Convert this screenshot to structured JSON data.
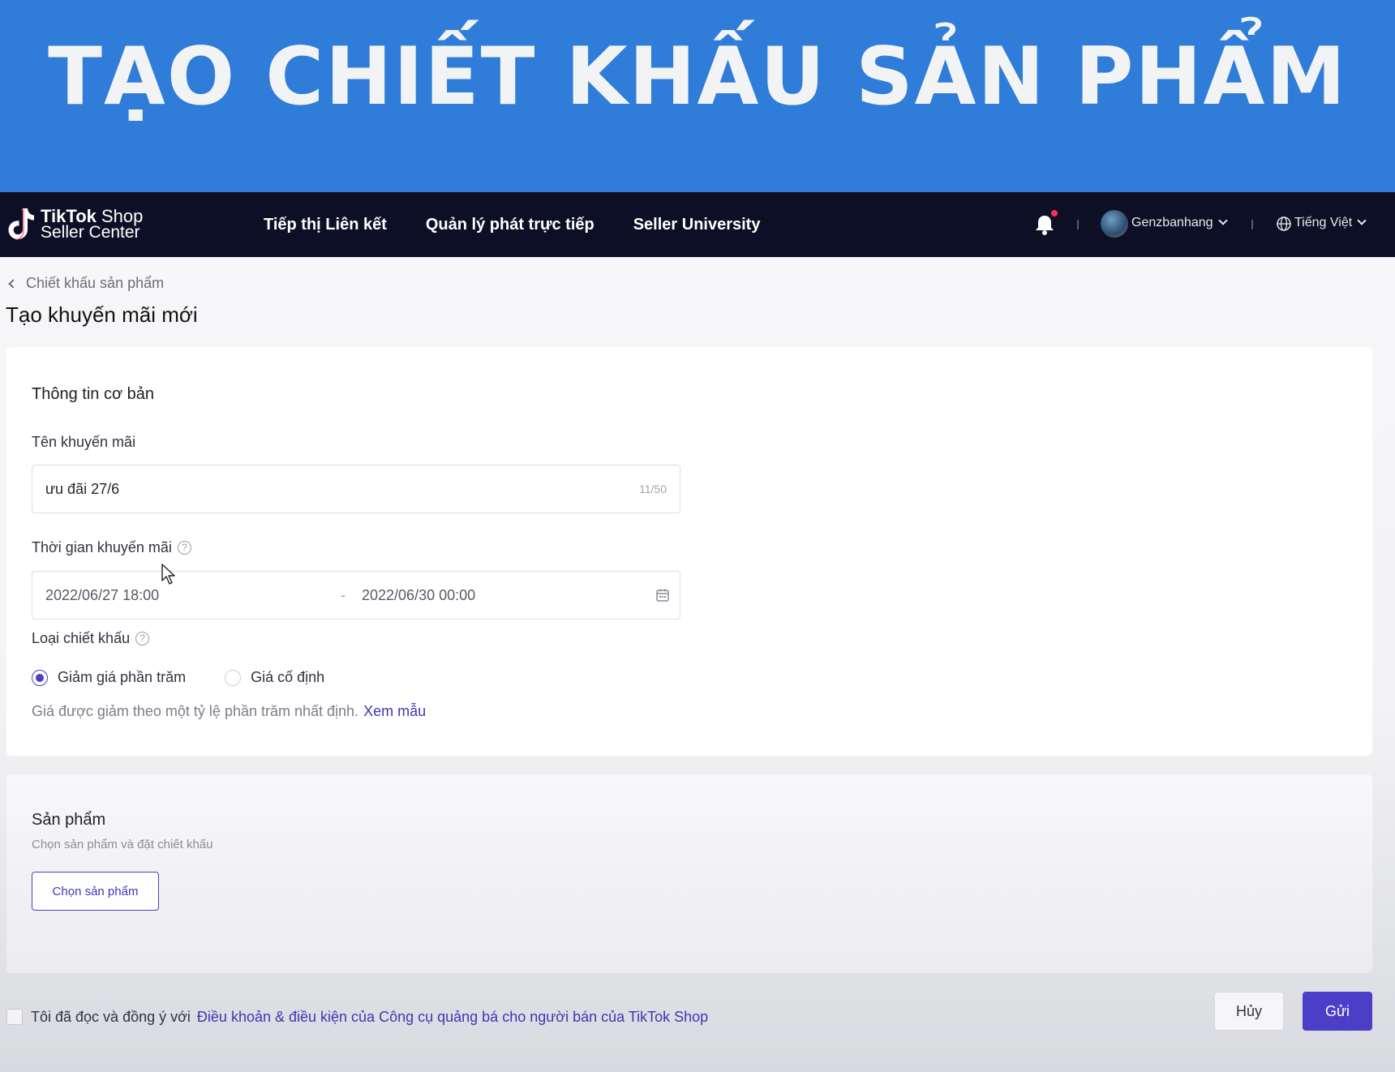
{
  "banner": {
    "title": "TẠO CHIẾT KHẤU SẢN PHẨM"
  },
  "nav": {
    "logo_brand": "TikTok",
    "logo_shop": "Shop",
    "logo_sub": "Seller Center",
    "links": [
      "Tiếp thị Liên kết",
      "Quản lý phát trực tiếp",
      "Seller University"
    ],
    "username": "Genzbanhang",
    "language": "Tiếng Việt",
    "icons": {
      "notifications": "bell-icon",
      "language": "globe-icon"
    }
  },
  "page": {
    "breadcrumb": "Chiết khấu sản phẩm",
    "title": "Tạo khuyến mãi mới"
  },
  "basic_info": {
    "section_title": "Thông tin cơ bản",
    "name_label": "Tên khuyến mãi",
    "name_value": "ưu đãi 27/6",
    "name_counter": "11/50",
    "time_label": "Thời gian khuyến mãi",
    "time_start": "2022/06/27 18:00",
    "time_separator": "-",
    "time_end": "2022/06/30 00:00",
    "discount_type_label": "Loại chiết khấu",
    "options": [
      "Giảm giá phần trăm",
      "Giá cố định"
    ],
    "selected_option": "Giảm giá phần trăm",
    "hint": "Giá được giảm theo một tỷ lệ phần trăm nhất định.",
    "hint_link": "Xem mẫu"
  },
  "products": {
    "section_title": "Sản phẩm",
    "description": "Chọn sản phẩm và đặt chiết khấu",
    "choose_button": "Chọn sản phẩm"
  },
  "footer": {
    "agree_text": "Tôi đã đọc và đồng ý với",
    "agree_link": "Điều khoản & điều kiện của Công cụ quảng bá cho người bán của TikTok Shop",
    "cancel": "Hủy",
    "submit": "Gửi"
  },
  "colors": {
    "banner": "#2f7dd8",
    "nav": "#0d0f26",
    "accent": "#4b3fc8",
    "notification_dot": "#ff2d55"
  }
}
